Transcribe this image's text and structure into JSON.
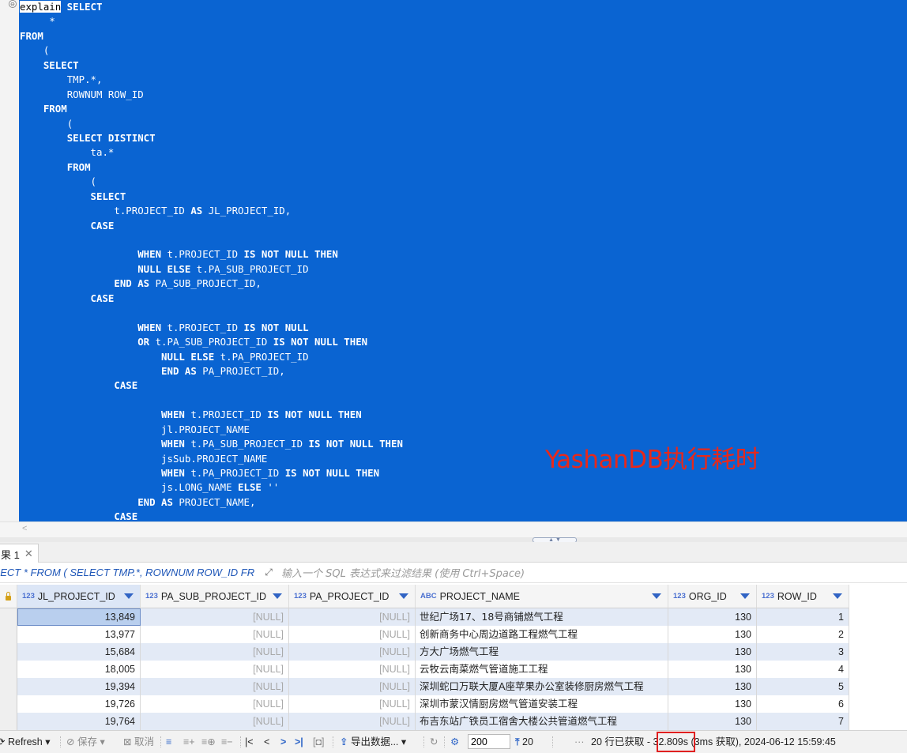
{
  "editor": {
    "fold_marker": "⊖",
    "lines": [
      {
        "i": 0,
        "segs": [
          {
            "t": "explain",
            "k": "first"
          },
          {
            "t": " SELECT",
            "k": "kw"
          }
        ]
      },
      {
        "i": 5,
        "segs": [
          {
            "t": "*",
            "k": ""
          }
        ]
      },
      {
        "i": 0,
        "segs": [
          {
            "t": "FROM",
            "k": "kw"
          }
        ]
      },
      {
        "i": 4,
        "segs": [
          {
            "t": "(",
            "k": ""
          }
        ]
      },
      {
        "i": 4,
        "segs": [
          {
            "t": "SELECT",
            "k": "kw"
          }
        ]
      },
      {
        "i": 8,
        "segs": [
          {
            "t": "TMP.*,",
            "k": ""
          }
        ]
      },
      {
        "i": 8,
        "segs": [
          {
            "t": "ROWNUM ROW_ID",
            "k": ""
          }
        ]
      },
      {
        "i": 4,
        "segs": [
          {
            "t": "FROM",
            "k": "kw"
          }
        ]
      },
      {
        "i": 8,
        "segs": [
          {
            "t": "(",
            "k": ""
          }
        ]
      },
      {
        "i": 8,
        "segs": [
          {
            "t": "SELECT DISTINCT",
            "k": "kw"
          }
        ]
      },
      {
        "i": 12,
        "segs": [
          {
            "t": "ta.*",
            "k": ""
          }
        ]
      },
      {
        "i": 8,
        "segs": [
          {
            "t": "FROM",
            "k": "kw"
          }
        ]
      },
      {
        "i": 12,
        "segs": [
          {
            "t": "(",
            "k": ""
          }
        ]
      },
      {
        "i": 12,
        "segs": [
          {
            "t": "SELECT",
            "k": "kw"
          }
        ]
      },
      {
        "i": 16,
        "segs": [
          {
            "t": "t.PROJECT_ID ",
            "k": ""
          },
          {
            "t": "AS",
            "k": "kw"
          },
          {
            "t": " JL_PROJECT_ID,",
            "k": ""
          }
        ]
      },
      {
        "i": 12,
        "segs": [
          {
            "t": "CASE",
            "k": "kw"
          }
        ]
      },
      {
        "i": 0,
        "segs": []
      },
      {
        "i": 20,
        "segs": [
          {
            "t": "WHEN",
            "k": "kw"
          },
          {
            "t": " t.PROJECT_ID ",
            "k": ""
          },
          {
            "t": "IS NOT NULL THEN",
            "k": "kw"
          }
        ]
      },
      {
        "i": 20,
        "segs": [
          {
            "t": "NULL ELSE",
            "k": "kw"
          },
          {
            "t": " t.PA_SUB_PROJECT_ID",
            "k": ""
          }
        ]
      },
      {
        "i": 16,
        "segs": [
          {
            "t": "END AS",
            "k": "kw"
          },
          {
            "t": " PA_SUB_PROJECT_ID,",
            "k": ""
          }
        ]
      },
      {
        "i": 12,
        "segs": [
          {
            "t": "CASE",
            "k": "kw"
          }
        ]
      },
      {
        "i": 0,
        "segs": []
      },
      {
        "i": 20,
        "segs": [
          {
            "t": "WHEN",
            "k": "kw"
          },
          {
            "t": " t.PROJECT_ID ",
            "k": ""
          },
          {
            "t": "IS NOT NULL",
            "k": "kw"
          }
        ]
      },
      {
        "i": 20,
        "segs": [
          {
            "t": "OR",
            "k": "kw"
          },
          {
            "t": " t.PA_SUB_PROJECT_ID ",
            "k": ""
          },
          {
            "t": "IS NOT NULL THEN",
            "k": "kw"
          }
        ]
      },
      {
        "i": 24,
        "segs": [
          {
            "t": "NULL ELSE",
            "k": "kw"
          },
          {
            "t": " t.PA_PROJECT_ID",
            "k": ""
          }
        ]
      },
      {
        "i": 24,
        "segs": [
          {
            "t": "END AS",
            "k": "kw"
          },
          {
            "t": " PA_PROJECT_ID,",
            "k": ""
          }
        ]
      },
      {
        "i": 16,
        "segs": [
          {
            "t": "CASE",
            "k": "kw"
          }
        ]
      },
      {
        "i": 0,
        "segs": []
      },
      {
        "i": 24,
        "segs": [
          {
            "t": "WHEN",
            "k": "kw"
          },
          {
            "t": " t.PROJECT_ID ",
            "k": ""
          },
          {
            "t": "IS NOT NULL THEN",
            "k": "kw"
          }
        ]
      },
      {
        "i": 24,
        "segs": [
          {
            "t": "jl.PROJECT_NAME",
            "k": ""
          }
        ]
      },
      {
        "i": 24,
        "segs": [
          {
            "t": "WHEN",
            "k": "kw"
          },
          {
            "t": " t.PA_SUB_PROJECT_ID ",
            "k": ""
          },
          {
            "t": "IS NOT NULL THEN",
            "k": "kw"
          }
        ]
      },
      {
        "i": 24,
        "segs": [
          {
            "t": "jsSub.PROJECT_NAME",
            "k": ""
          }
        ]
      },
      {
        "i": 24,
        "segs": [
          {
            "t": "WHEN",
            "k": "kw"
          },
          {
            "t": " t.PA_PROJECT_ID ",
            "k": ""
          },
          {
            "t": "IS NOT NULL THEN",
            "k": "kw"
          }
        ]
      },
      {
        "i": 24,
        "segs": [
          {
            "t": "js.LONG_NAME ",
            "k": ""
          },
          {
            "t": "ELSE",
            "k": "kw"
          },
          {
            "t": " ''",
            "k": ""
          }
        ]
      },
      {
        "i": 20,
        "segs": [
          {
            "t": "END AS",
            "k": "kw"
          },
          {
            "t": " PROJECT_NAME,",
            "k": ""
          }
        ]
      },
      {
        "i": 16,
        "segs": [
          {
            "t": "CASE",
            "k": "kw"
          }
        ]
      }
    ],
    "annotation": "YashanDB执行耗时"
  },
  "result_tab": {
    "label": "果 1",
    "close": "✕"
  },
  "filter": {
    "query": "LECT * FROM ( SELECT TMP.*, ROWNUM ROW_ID FR",
    "placeholder": "输入一个 SQL 表达式来过滤结果 (使用 Ctrl+Space)"
  },
  "grid": {
    "columns": [
      {
        "name": "JL_PROJECT_ID",
        "type": "123"
      },
      {
        "name": "PA_SUB_PROJECT_ID",
        "type": "123"
      },
      {
        "name": "PA_PROJECT_ID",
        "type": "123"
      },
      {
        "name": "PROJECT_NAME",
        "type": "ABC"
      },
      {
        "name": "ORG_ID",
        "type": "123"
      },
      {
        "name": "ROW_ID",
        "type": "123"
      }
    ],
    "rows": [
      [
        "13,849",
        "[NULL]",
        "[NULL]",
        "世纪广场17、18号商铺燃气工程",
        "130",
        "1"
      ],
      [
        "13,977",
        "[NULL]",
        "[NULL]",
        "创新商务中心周边道路工程燃气工程",
        "130",
        "2"
      ],
      [
        "15,684",
        "[NULL]",
        "[NULL]",
        "方大广场燃气工程",
        "130",
        "3"
      ],
      [
        "18,005",
        "[NULL]",
        "[NULL]",
        "云牧云南菜燃气管道施工工程",
        "130",
        "4"
      ],
      [
        "19,394",
        "[NULL]",
        "[NULL]",
        "深圳蛇口万联大厦A座苹果办公室装修厨房燃气工程",
        "130",
        "5"
      ],
      [
        "19,726",
        "[NULL]",
        "[NULL]",
        "深圳市蒙汉情厨房燃气管道安装工程",
        "130",
        "6"
      ],
      [
        "19,764",
        "[NULL]",
        "[NULL]",
        "布吉东站广铁员工宿舍大楼公共管道燃气工程",
        "130",
        "7"
      ]
    ]
  },
  "statusbar": {
    "refresh": "Refresh",
    "save": "保存",
    "cancel": "取消",
    "export": "导出数据...",
    "fetch_size": "200",
    "fetch_count": "20",
    "ellipsis": "···",
    "summary_prefix": "20 行已获取 - ",
    "exec_time": "32.809s",
    "summary_suffix": " (3ms 获取), 2024-06-12 15:59:45"
  }
}
